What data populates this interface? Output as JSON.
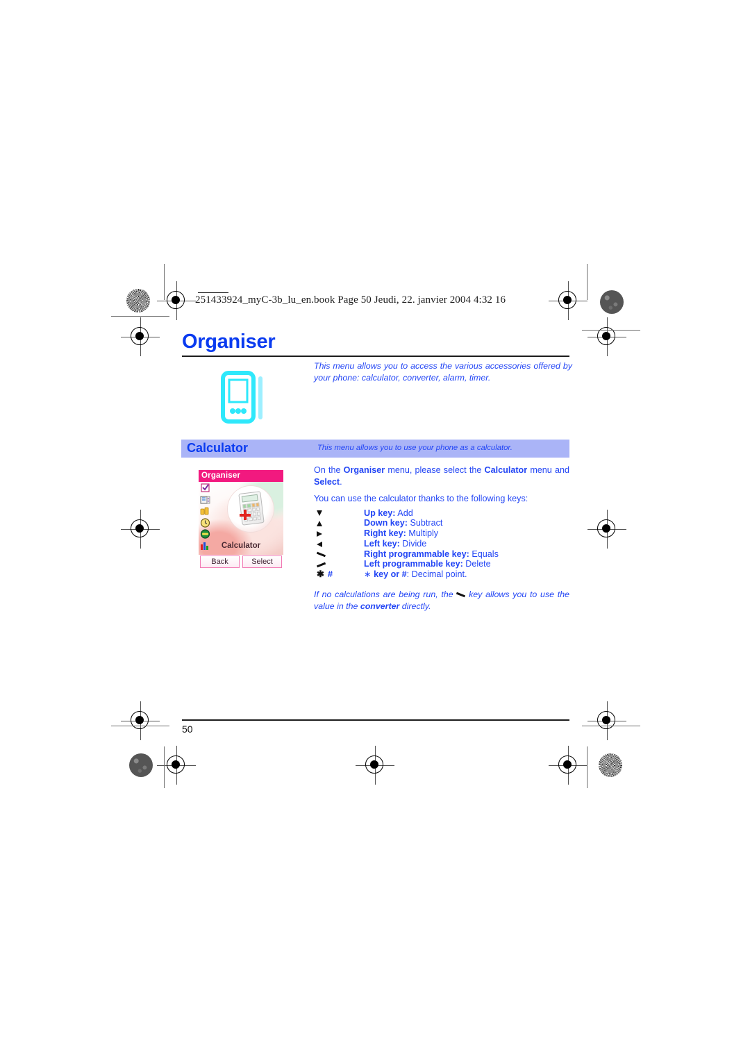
{
  "page": {
    "header_line": "251433924_myC-3b_lu_en.book  Page 50  Jeudi, 22. janvier 2004  4:32 16",
    "folio": "50"
  },
  "chapter": {
    "title": "Organiser",
    "intro": "This menu allows you to access the various accessories offered by your phone: calculator, converter, alarm, timer.",
    "icon": "pda-organiser-icon"
  },
  "section": {
    "title": "Calculator",
    "note": "This menu allows you to use your phone as a calculator.",
    "intro_prefix": "On the ",
    "intro_b1": "Organiser",
    "intro_mid1": " menu, please select the ",
    "intro_b2": "Calculator",
    "intro_mid2": " menu and ",
    "intro_b3": "Select",
    "intro_suffix": ".",
    "lead": "You can use the calculator thanks to the following keys:",
    "note_prefix": "If no calculations are being run, the ",
    "note_mid": " key allows you to use the value in the ",
    "note_b": "converter",
    "note_suffix": " directly."
  },
  "keys": [
    {
      "glyph": "up-key-icon",
      "label": "Up key:",
      "value": " Add"
    },
    {
      "glyph": "down-key-icon",
      "label": "Down key:",
      "value": " Subtract"
    },
    {
      "glyph": "right-key-icon",
      "label": "Right key:",
      "value": " Multiply"
    },
    {
      "glyph": "left-key-icon",
      "label": "Left key:",
      "value": " Divide"
    },
    {
      "glyph": "right-programmable-key-icon",
      "label": "Right programmable key:",
      "value": " Equals"
    },
    {
      "glyph": "left-programmable-key-icon",
      "label": "Left programmable key:",
      "value": " Delete"
    },
    {
      "glyph": "star-hash-key-icon",
      "label": "key or #",
      "value": ": Decimal point.",
      "prefix": "∗ "
    }
  ],
  "phone_shot": {
    "title": "Organiser",
    "selected_label": "Calculator",
    "softkey_left": "Back",
    "softkey_right": "Select",
    "menu_icons": [
      "tasks-icon",
      "notepad-icon",
      "converter-coins-icon",
      "alarm-clock-icon",
      "timer-icon",
      "bar-chart-icon"
    ]
  },
  "colors": {
    "link_blue": "#2346f5",
    "heading_blue": "#0a3bf0",
    "section_bar": "#aab4f7",
    "phone_title_pink": "#f2197f",
    "pda_cyan": "#2ee8fb"
  }
}
